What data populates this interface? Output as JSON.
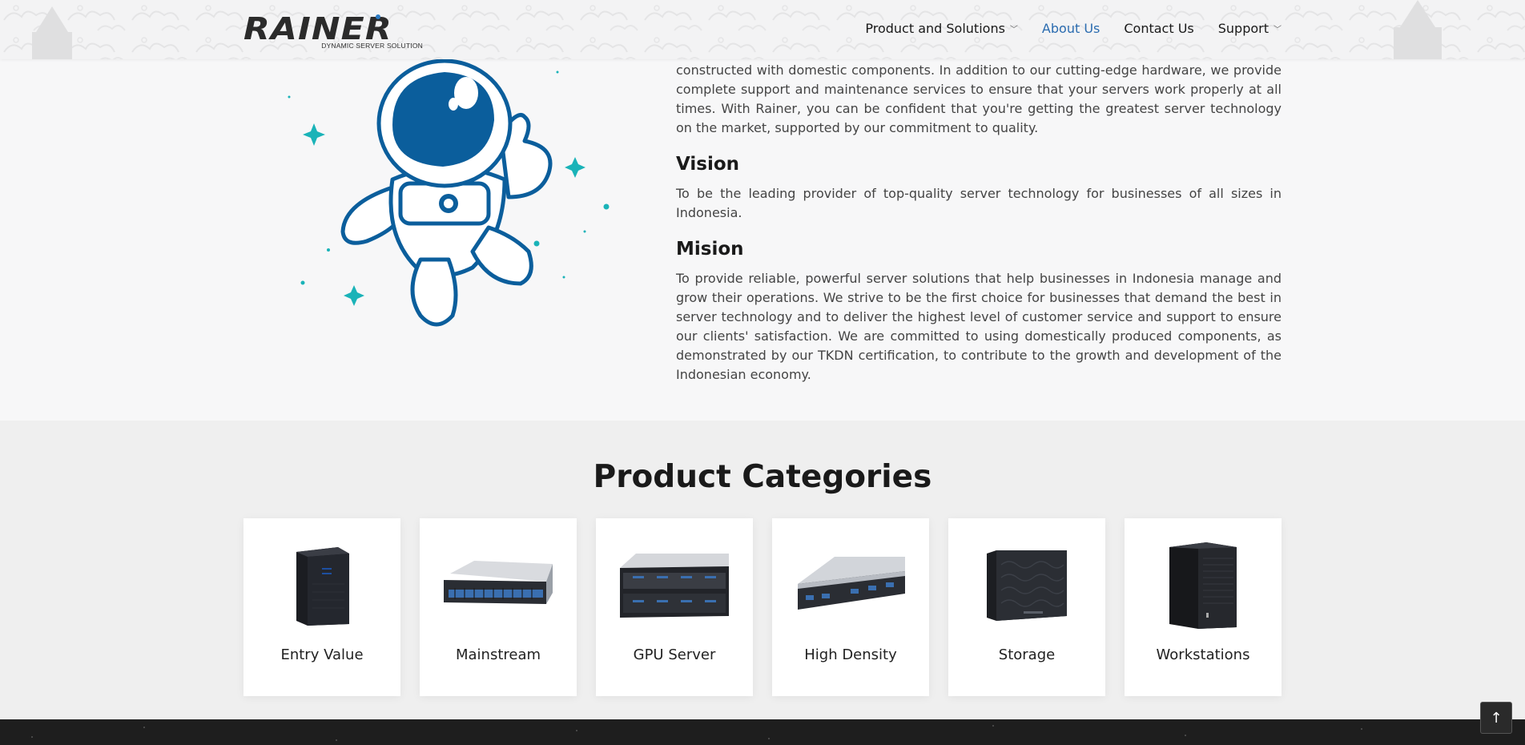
{
  "header": {
    "logo_text": "RAINER",
    "logo_tagline": "DYNAMIC SERVER SOLUTION",
    "nav": [
      {
        "label": "Product and Solutions",
        "has_dropdown": true,
        "active": false
      },
      {
        "label": "About Us",
        "has_dropdown": false,
        "active": true
      },
      {
        "label": "Contact Us",
        "has_dropdown": false,
        "active": false
      },
      {
        "label": "Support",
        "has_dropdown": true,
        "active": false
      }
    ]
  },
  "about": {
    "intro": "constructed with domestic components. In addition to our cutting-edge hardware, we provide complete support and maintenance services to ensure that your servers work properly at all times. With Rainer, you can be confident that you're getting the greatest server technology on the market, supported by our commitment to quality.",
    "vision_title": "Vision",
    "vision_text": "To be the leading provider of top-quality server technology for businesses of all sizes in Indonesia.",
    "mission_title": "Mision",
    "mission_text": "To provide reliable, powerful server solutions that help businesses in Indonesia manage and grow their operations. We strive to be the first choice for businesses that demand the best in server technology and to deliver the highest level of customer service and support to ensure our clients' satisfaction. We are committed to using domestically produced components, as demonstrated by our TKDN certification, to contribute to the growth and development of the Indonesian economy."
  },
  "categories": {
    "title": "Product Categories",
    "items": [
      {
        "label": "Entry Value",
        "icon": "tower-server-icon"
      },
      {
        "label": "Mainstream",
        "icon": "rack-server-2u-icon"
      },
      {
        "label": "GPU Server",
        "icon": "gpu-server-icon"
      },
      {
        "label": "High Density",
        "icon": "high-density-server-icon"
      },
      {
        "label": "Storage",
        "icon": "storage-cube-icon"
      },
      {
        "label": "Workstations",
        "icon": "workstation-tower-icon"
      }
    ]
  },
  "back_to_top": {
    "icon": "arrow-up-icon",
    "glyph": "↑"
  },
  "colors": {
    "accent": "#2b6cb0",
    "astronaut_blue": "#0b5e9c",
    "star_teal": "#1ab3b8",
    "footer": "#1e1e1e"
  }
}
